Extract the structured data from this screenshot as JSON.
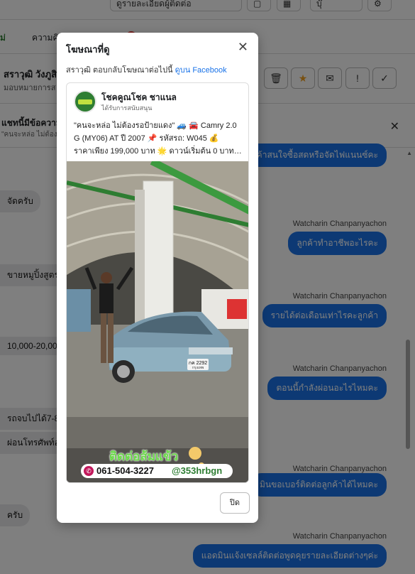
{
  "app": {
    "toolbar": {
      "btn1": "ดูรายละเอียดผู้ติดต่อ",
      "btn2": "บุ๊"
    },
    "tabs": {
      "tab1": "ม่",
      "tab2": "ความคิดเ"
    },
    "conversation": {
      "name": "สราวุฒิ วังภูสิ",
      "assign": "มอบหมายการส"
    },
    "banner": {
      "title": "แชทนี้มีข้อความ",
      "subtitle": "\"คนจะหล่อ ไม่ต้องร"
    },
    "incoming": [
      "จัดครับ",
      "ขายหมูปิ้งสูตรพ",
      "10,000-20,000",
      "รถจบไปได้7-8ปี",
      "ผ่อนโทรศัพท์อ",
      "ครับ"
    ],
    "outgoing": [
      {
        "sender": "",
        "text": "ค้าสนใจซื้อสดหรือจัดไฟแนนซ์คะ"
      },
      {
        "sender": "Watcharin Chanpanyachon",
        "text": "ลูกค้าทำอาชีพอะไรคะ"
      },
      {
        "sender": "Watcharin Chanpanyachon",
        "text": "รายได้ต่อเดือนเท่าไรคะลูกค้า"
      },
      {
        "sender": "Watcharin Chanpanyachon",
        "text": "ตอนนี้กำลังผ่อนอะไรไหมคะ"
      },
      {
        "sender": "Watcharin Chanpanyachon",
        "text": "มินขอเบอร์ติดต่อลูกค้าได้ไหมคะ"
      },
      {
        "sender": "Watcharin Chanpanyachon",
        "text": "แอดมินแจ้งเซลล์ติดต่อพูดคุยรายละเอียดต่างๆค่ะ"
      }
    ]
  },
  "modal": {
    "title": "โฆษณาที่ดู",
    "subtitle_prefix": "สราวุฒิ ตอบกลับโฆษณาต่อไปนี้",
    "subtitle_link": "ดูบน Facebook",
    "close_label": "ปิด",
    "post": {
      "page_name": "โชคคูณโชค ชาแนล",
      "sponsored": "ได้รับการสนับสนุน",
      "caption_line1": "\"คนจะหล่อ ไม่ต้องรอป้ายแดง\" 🚙 🚘 Camry 2.0",
      "caption_line2": "G (MY06) AT ปี 2007 📌 รหัสรถ: W045 💰",
      "caption_line3": "ราคาเพียง 199,000 บาท 🌟 ดาวน์เริ่มต้น 0 บาท…",
      "overlay_contact": "ติดต่อส้มแข้ว",
      "phone": "061-504-3227",
      "line_id": "@353hrbgn",
      "plate_line1": "กค 2292",
      "plate_line2": "กรุงเทพ"
    }
  }
}
